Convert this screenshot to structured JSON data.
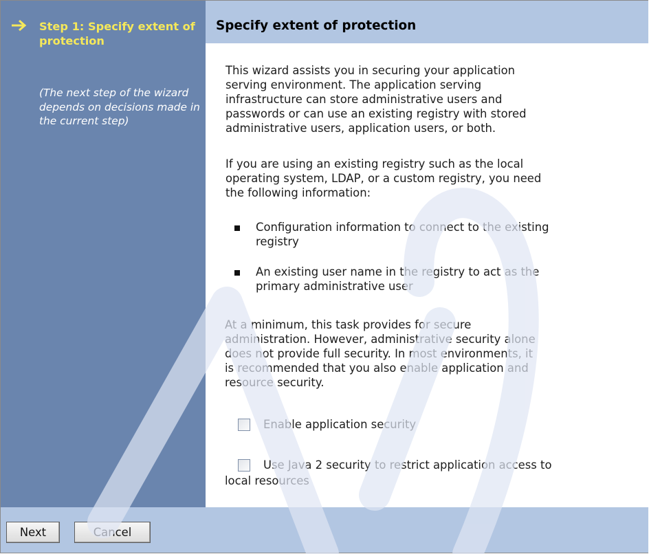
{
  "sidebar": {
    "current_step_title": "Step 1: Specify extent of protection",
    "step_note": "(The next step of the wizard depends on decisions made in the current step)",
    "step_icon": "right-arrow-icon",
    "title_color": "#f5e85a",
    "background_color": "#6a85ae"
  },
  "main": {
    "title": "Specify extent of protection",
    "header_color": "#b2c6e2",
    "intro_lines": [
      "This wizard assists you in securing your application",
      "serving environment. The application serving",
      "infrastructure can store administrative users and",
      "passwords or can use an existing registry with stored",
      "administrative users, application users, or both."
    ],
    "registry_lines": [
      "If you are using an existing registry such as the local",
      "operating system, LDAP, or a custom registry, you need",
      "the following information:"
    ],
    "requirements": [
      {
        "lines": [
          "Configuration information to connect to the existing",
          "registry"
        ]
      },
      {
        "lines": [
          "An existing user name in the registry to act as the",
          "primary administrative user"
        ]
      }
    ],
    "minimum_lines": [
      "At a minimum, this task provides for secure",
      "administration. However, administrative security alone",
      "does not provide full security. In most environments, it",
      "is recommended that you also enable application and",
      "resource security."
    ],
    "options": {
      "app_security": {
        "label": "Enable application security",
        "checked": false
      },
      "java2_security": {
        "label_line1": "Use Java 2 security to restrict application access to",
        "label_line2": "local resources",
        "checked": false
      }
    }
  },
  "footer": {
    "next_label": "Next",
    "cancel_label": "Cancel"
  }
}
